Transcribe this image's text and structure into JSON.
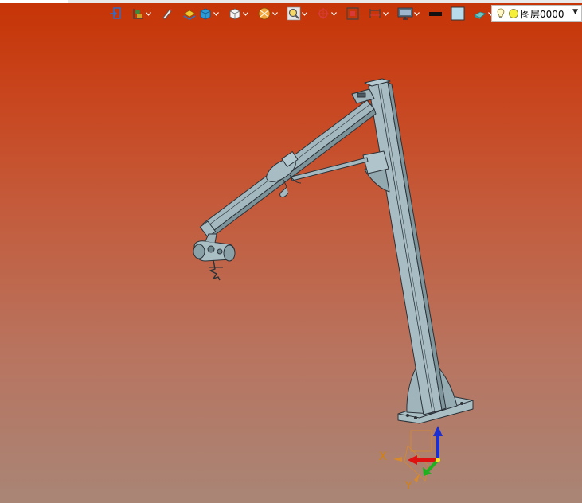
{
  "toolbar": {
    "items": [
      {
        "name": "exit-sketch-icon",
        "has_menu": false
      },
      {
        "name": "snap-tools-icon",
        "has_menu": true
      },
      {
        "name": "pencil-icon",
        "has_menu": false
      },
      {
        "name": "layer-stack-icon",
        "has_menu": false
      },
      {
        "name": "solid-cube-icon",
        "has_menu": true
      },
      {
        "name": "view-cube-icon",
        "has_menu": true
      },
      {
        "name": "section-view-icon",
        "has_menu": true
      },
      {
        "name": "zoom-icon",
        "has_menu": true
      },
      {
        "name": "snap-point-icon",
        "has_menu": true
      },
      {
        "name": "fit-view-icon",
        "has_menu": false
      },
      {
        "name": "dimension-icon",
        "has_menu": true
      },
      {
        "name": "display-monitor-icon",
        "has_menu": true
      },
      {
        "name": "line-style-icon",
        "has_menu": false
      },
      {
        "name": "color-swatch-icon",
        "has_menu": false
      },
      {
        "name": "surface-icon",
        "has_menu": true
      }
    ]
  },
  "layer": {
    "name": "图层0000",
    "bulb_icon": "lightbulb-icon",
    "status_icon": "yellow-circle-icon"
  },
  "viewport": {
    "background_top": "#c63406",
    "background_bottom": "#a98576",
    "model_color": "#9fb7bd"
  },
  "triad": {
    "x_label": "X",
    "y_label": "Y"
  }
}
